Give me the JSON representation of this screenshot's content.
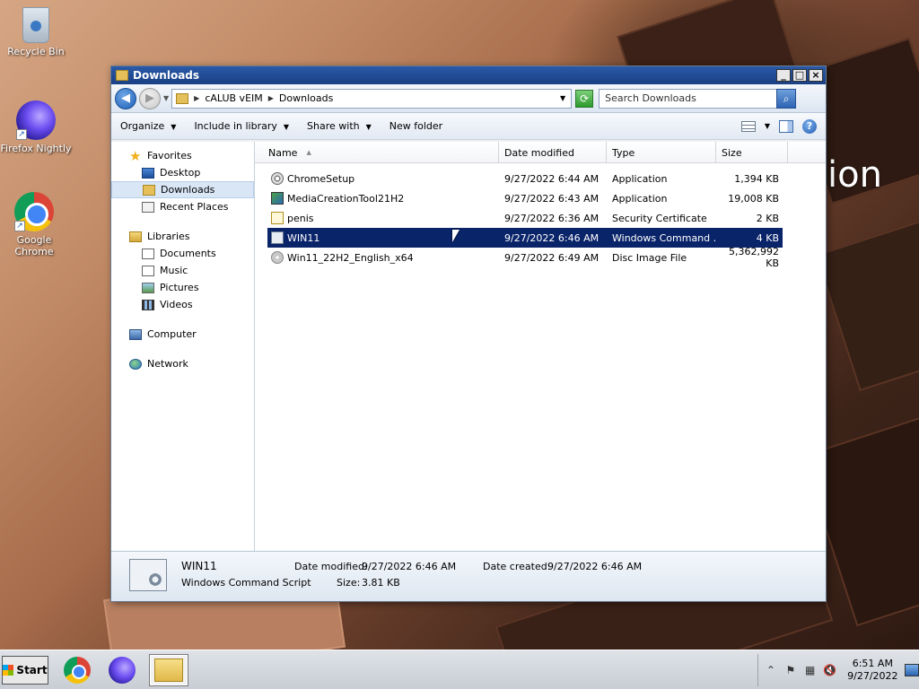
{
  "desktop": {
    "icons": [
      {
        "label": "Recycle Bin",
        "icon": "recycle-bin-icon"
      },
      {
        "label": "Firefox Nightly",
        "icon": "firefox-nightly-icon"
      },
      {
        "label": "Google Chrome",
        "icon": "google-chrome-icon"
      }
    ],
    "wallpaper_text": "ion"
  },
  "window": {
    "title": "Downloads",
    "address": {
      "segments": [
        "cALUB vEIM",
        "Downloads"
      ]
    },
    "search": {
      "placeholder": "Search Downloads"
    },
    "commands": {
      "organize": "Organize",
      "include_in_library": "Include in library",
      "share_with": "Share with",
      "new_folder": "New folder"
    },
    "nav": {
      "favorites": {
        "label": "Favorites",
        "items": [
          "Desktop",
          "Downloads",
          "Recent Places"
        ]
      },
      "libraries": {
        "label": "Libraries",
        "items": [
          "Documents",
          "Music",
          "Pictures",
          "Videos"
        ]
      },
      "computer": "Computer",
      "network": "Network"
    },
    "columns": {
      "name": "Name",
      "date": "Date modified",
      "type": "Type",
      "size": "Size"
    },
    "files": [
      {
        "name": "ChromeSetup",
        "date": "9/27/2022 6:44 AM",
        "type": "Application",
        "size": "1,394 KB",
        "icon": "application-icon"
      },
      {
        "name": "MediaCreationTool21H2",
        "date": "9/27/2022 6:43 AM",
        "type": "Application",
        "size": "19,008 KB",
        "icon": "media-creation-tool-icon"
      },
      {
        "name": "penis",
        "date": "9/27/2022 6:36 AM",
        "type": "Security Certificate",
        "size": "2 KB",
        "icon": "certificate-icon"
      },
      {
        "name": "WIN11",
        "date": "9/27/2022 6:46 AM",
        "type": "Windows Command ...",
        "size": "4 KB",
        "icon": "command-script-icon",
        "selected": true
      },
      {
        "name": "Win11_22H2_English_x64",
        "date": "9/27/2022 6:49 AM",
        "type": "Disc Image File",
        "size": "5,362,992 KB",
        "icon": "disc-image-icon"
      }
    ],
    "details": {
      "name": "WIN11",
      "kind": "Windows Command Script",
      "date_modified_label": "Date modified:",
      "date_modified": "9/27/2022 6:46 AM",
      "date_created_label": "Date created:",
      "date_created": "9/27/2022 6:46 AM",
      "size_label": "Size:",
      "size": "3.81 KB"
    }
  },
  "taskbar": {
    "start_label": "Start",
    "clock_time": "6:51 AM",
    "clock_date": "9/27/2022"
  },
  "colors": {
    "selection": "#0a246a",
    "titlebar": "#1a3f84"
  }
}
